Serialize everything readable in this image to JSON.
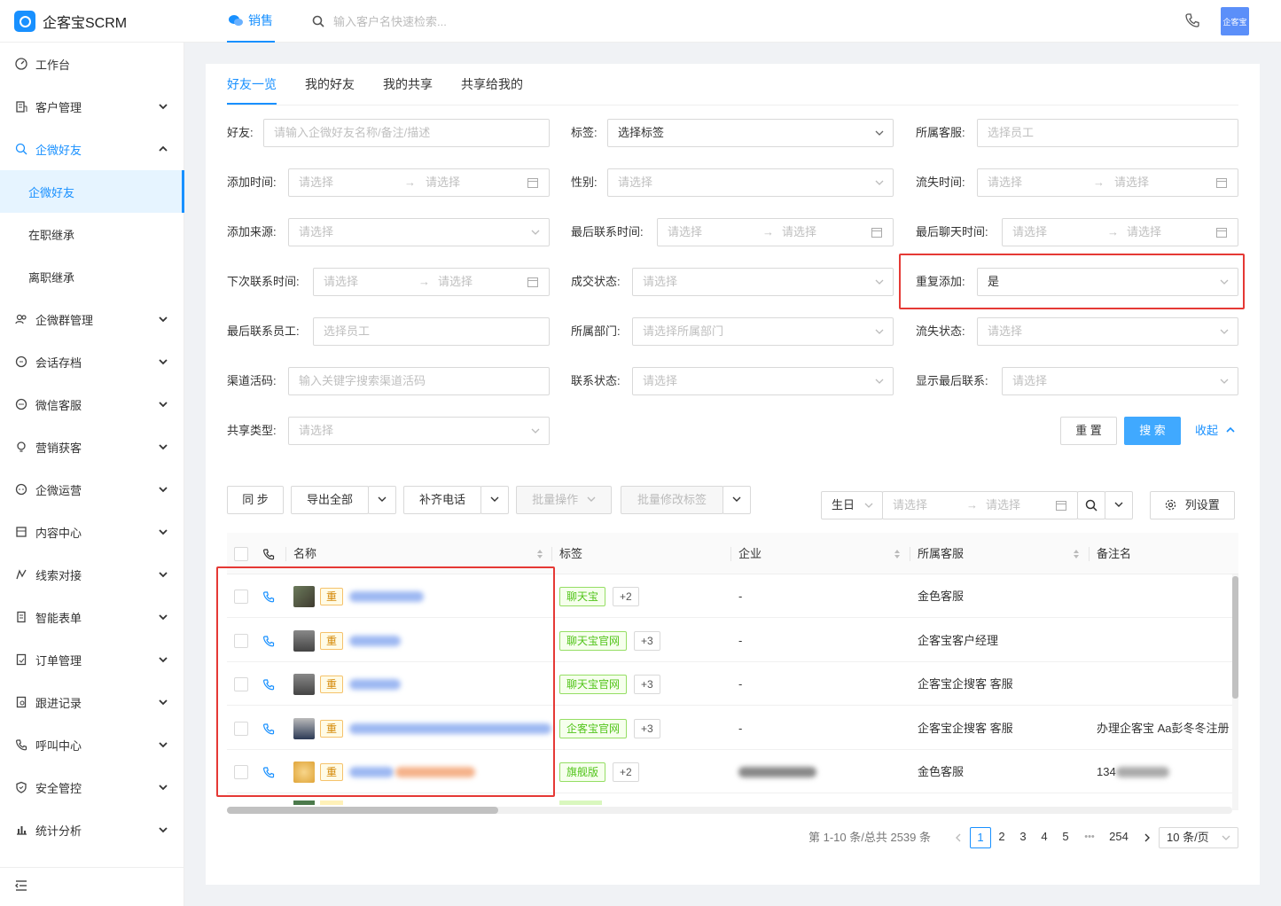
{
  "app": {
    "title": "企客宝SCRM",
    "avatar_text": "企客宝"
  },
  "topbar": {
    "tab": "销售",
    "search_placeholder": "输入客户名快速检索..."
  },
  "sidebar": {
    "items": [
      {
        "label": "工作台",
        "icon": "dashboard-icon"
      },
      {
        "label": "客户管理",
        "icon": "building-icon"
      },
      {
        "label": "企微好友",
        "icon": "friends-icon"
      },
      {
        "label": "企微好友",
        "icon": ""
      },
      {
        "label": "在职继承",
        "icon": ""
      },
      {
        "label": "离职继承",
        "icon": ""
      },
      {
        "label": "企微群管理",
        "icon": "group-icon"
      },
      {
        "label": "会话存档",
        "icon": "chat-icon"
      },
      {
        "label": "微信客服",
        "icon": "service-icon"
      },
      {
        "label": "营销获客",
        "icon": "bulb-icon"
      },
      {
        "label": "企微运营",
        "icon": "ops-icon"
      },
      {
        "label": "内容中心",
        "icon": "content-icon"
      },
      {
        "label": "线索对接",
        "icon": "lead-icon"
      },
      {
        "label": "智能表单",
        "icon": "form-icon"
      },
      {
        "label": "订单管理",
        "icon": "order-icon"
      },
      {
        "label": "跟进记录",
        "icon": "record-icon"
      },
      {
        "label": "呼叫中心",
        "icon": "call-icon"
      },
      {
        "label": "安全管控",
        "icon": "shield-icon"
      },
      {
        "label": "统计分析",
        "icon": "chart-icon"
      }
    ]
  },
  "tabs": [
    "好友一览",
    "我的好友",
    "我的共享",
    "共享给我的"
  ],
  "filters": {
    "friend": {
      "label": "好友:",
      "placeholder": "请输入企微好友名称/备注/描述"
    },
    "tag": {
      "label": "标签:",
      "placeholder": "选择标签"
    },
    "owner": {
      "label": "所属客服:",
      "placeholder": "选择员工"
    },
    "add_time": {
      "label": "添加时间:",
      "from": "请选择",
      "to": "请选择"
    },
    "gender": {
      "label": "性别:",
      "placeholder": "请选择"
    },
    "lost_time": {
      "label": "流失时间:",
      "from": "请选择",
      "to": "请选择"
    },
    "source": {
      "label": "添加来源:",
      "placeholder": "请选择"
    },
    "last_contact_time": {
      "label": "最后联系时间:",
      "from": "请选择",
      "to": "请选择"
    },
    "last_chat_time": {
      "label": "最后聊天时间:",
      "from": "请选择",
      "to": "请选择"
    },
    "next_contact_time": {
      "label": "下次联系时间:",
      "from": "请选择",
      "to": "请选择"
    },
    "deal_status": {
      "label": "成交状态:",
      "placeholder": "请选择"
    },
    "repeat_add": {
      "label": "重复添加:",
      "value": "是"
    },
    "last_contact_staff": {
      "label": "最后联系员工:",
      "placeholder": "选择员工"
    },
    "department": {
      "label": "所属部门:",
      "placeholder": "请选择所属部门"
    },
    "lost_status": {
      "label": "流失状态:",
      "placeholder": "请选择"
    },
    "channel_code": {
      "label": "渠道活码:",
      "placeholder": "输入关键字搜索渠道活码"
    },
    "contact_status": {
      "label": "联系状态:",
      "placeholder": "请选择"
    },
    "show_last_contact": {
      "label": "显示最后联系:",
      "placeholder": "请选择"
    },
    "share_type": {
      "label": "共享类型:",
      "placeholder": "请选择"
    },
    "reset": "重 置",
    "search": "搜 索",
    "collapse": "收起"
  },
  "toolbar": {
    "sync": "同 步",
    "export_all": "导出全部",
    "fill_phone": "补齐电话",
    "batch_ops": "批量操作",
    "batch_tags": "批量修改标签",
    "date_type": "生日",
    "date_from": "请选择",
    "date_to": "请选择",
    "column_settings": "列设置"
  },
  "table": {
    "columns": [
      "名称",
      "标签",
      "企业",
      "所属客服",
      "备注名"
    ],
    "repeat_badge": "重",
    "rows": [
      {
        "tag": "聊天宝",
        "more": "+2",
        "company": "-",
        "owner": "金色客服",
        "remark": ""
      },
      {
        "tag": "聊天宝官网",
        "more": "+3",
        "company": "-",
        "owner": "企客宝客户经理",
        "remark": ""
      },
      {
        "tag": "聊天宝官网",
        "more": "+3",
        "company": "-",
        "owner": "企客宝企搜客 客服",
        "remark": ""
      },
      {
        "tag": "企客宝官网",
        "more": "+3",
        "company": "-",
        "owner": "企客宝企搜客 客服",
        "remark": "办理企客宝 Aa彭冬冬注册"
      },
      {
        "tag": "旗舰版",
        "more": "+2",
        "company": "",
        "owner": "金色客服",
        "remark": "134"
      }
    ]
  },
  "pagination": {
    "summary": "第 1-10 条/总共 2539 条",
    "pages": [
      "1",
      "2",
      "3",
      "4",
      "5",
      "•••",
      "254"
    ],
    "page_size": "10 条/页"
  },
  "colors": {
    "primary": "#1890ff",
    "highlight": "#e53935",
    "tag_green": "#52c41a"
  }
}
